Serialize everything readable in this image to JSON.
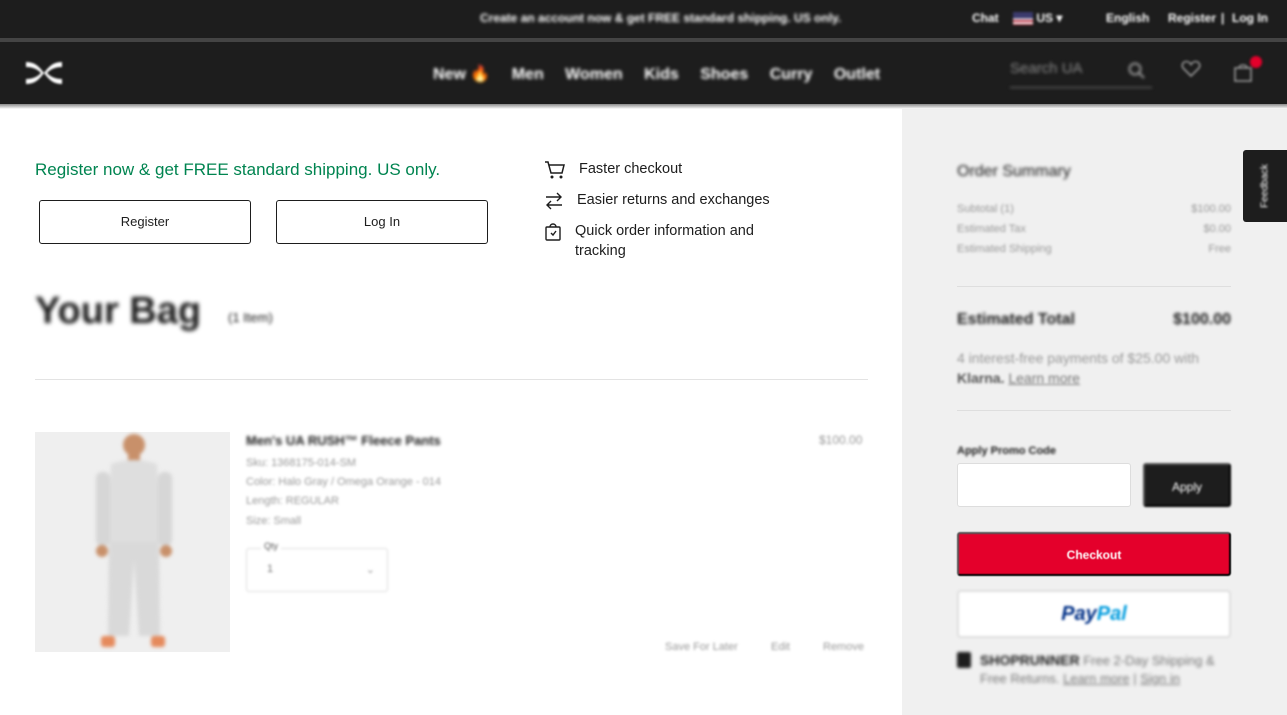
{
  "topbar": {
    "promo": "Create an account now & get FREE standard shipping. US only.",
    "chat": "Chat",
    "country": "US",
    "language": "English",
    "register": "Register",
    "divider": "|",
    "login": "Log In"
  },
  "nav": {
    "items": [
      "New 🔥",
      "Men",
      "Women",
      "Kids",
      "Shoes",
      "Curry",
      "Outlet"
    ],
    "search_placeholder": "Search UA",
    "cart_count": "1"
  },
  "register_panel": {
    "headline": "Register now & get FREE standard shipping. US only.",
    "register_label": "Register",
    "login_label": "Log In",
    "benefits": [
      "Faster checkout",
      "Easier returns and exchanges",
      "Quick order information and",
      "tracking"
    ]
  },
  "bag": {
    "title": "Your Bag",
    "count": "(1 Item)",
    "item": {
      "name": "Men's UA RUSH™ Fleece Pants",
      "sku": "Sku: 1368175-014-SM",
      "color": "Color: Halo Gray / Omega Orange - 014",
      "length": "Length: REGULAR",
      "size": "Size: Small",
      "qty_label": "Qty",
      "qty_value": "1",
      "price": "$100.00",
      "actions": [
        "Save For Later",
        "Edit",
        "Remove"
      ]
    }
  },
  "summary": {
    "title": "Order Summary",
    "rows": [
      {
        "label": "Subtotal (1)",
        "value": "$100.00"
      },
      {
        "label": "Estimated Tax",
        "value": "$0.00"
      },
      {
        "label": "Estimated Shipping",
        "value": "Free"
      }
    ],
    "total_label": "Estimated Total",
    "total_value": "$100.00",
    "klarna_text": "4 interest-free payments of $25.00 with",
    "klarna_brand": "Klarna.",
    "klarna_link": "Learn more",
    "promo_label": "Apply Promo Code",
    "apply_label": "Apply",
    "checkout_label": "Checkout",
    "paypal_a": "Pay",
    "paypal_b": "Pal",
    "shoprunner_brand": "SHOPRUNNER",
    "shoprunner_text": "Free 2-Day Shipping & Free Returns.",
    "shoprunner_learn": "Learn more",
    "shoprunner_sep": "|",
    "shoprunner_signin": "Sign in"
  },
  "feedback_label": "Feedback"
}
